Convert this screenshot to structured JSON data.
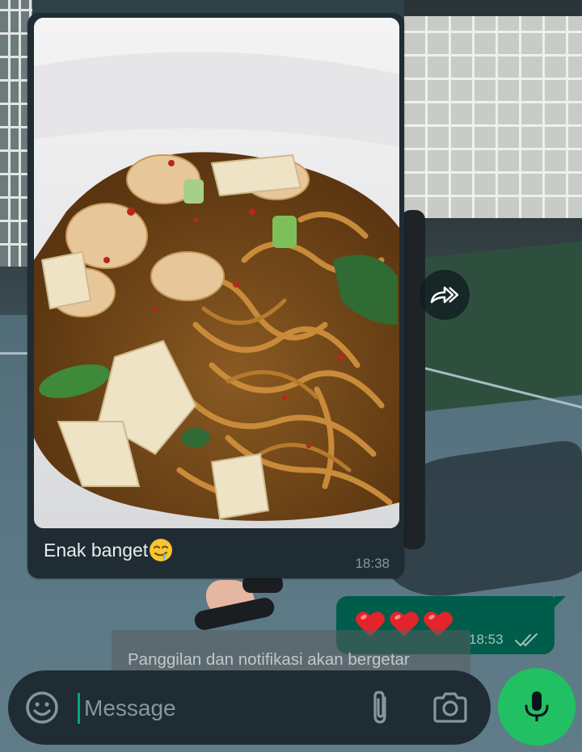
{
  "chat": {
    "incoming": {
      "caption": "Enak banget",
      "emoji": "drooling-face",
      "time": "18:38"
    },
    "outgoing": {
      "text_emoji": "❤️❤️❤️",
      "time": "18:53",
      "status": "delivered-double-check"
    }
  },
  "toast": {
    "text": "Panggilan dan notifikasi akan bergetar"
  },
  "composer": {
    "placeholder": "Message",
    "icons": [
      "emoji-icon",
      "paperclip-icon",
      "camera-icon",
      "microphone-icon"
    ]
  },
  "colors": {
    "bubble_incoming": "#1f2c33",
    "bubble_outgoing": "#005c4b",
    "accent_green": "#21c063",
    "timestamp": "#8696a0"
  }
}
